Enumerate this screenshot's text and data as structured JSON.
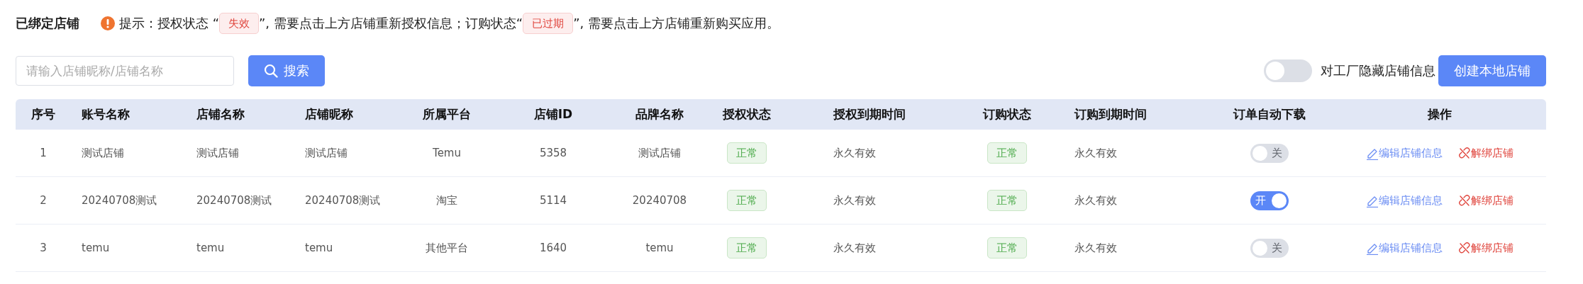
{
  "title": "已绑定店铺",
  "hint": [
    {
      "kind": "text",
      "text": "提示：授权状态 “"
    },
    {
      "kind": "tag",
      "text": "失效"
    },
    {
      "kind": "text",
      "text": "”, 需要点击上方店铺重新授权信息；订购状态“"
    },
    {
      "kind": "tag",
      "text": "已过期"
    },
    {
      "kind": "text",
      "text": "”, 需要点击上方店铺重新购买应用。"
    }
  ],
  "search": {
    "placeholder": "请输入店铺昵称/店铺名称",
    "button": "搜索"
  },
  "hide_from_factory": {
    "on": false,
    "label": "对工厂隐藏店铺信息"
  },
  "create_button": "创建本地店铺",
  "table": {
    "columns": [
      "序号",
      "账号名称",
      "店铺名称",
      "店铺昵称",
      "所属平台",
      "店铺ID",
      "品牌名称",
      "授权状态",
      "授权到期时间",
      "订购状态",
      "订购到期时间",
      "订单自动下载",
      "操作"
    ],
    "rows": [
      {
        "cells": [
          {
            "kind": "text",
            "text": "1"
          },
          {
            "kind": "text",
            "text": "测试店铺"
          },
          {
            "kind": "text",
            "text": "测试店铺"
          },
          {
            "kind": "text",
            "text": "测试店铺"
          },
          {
            "kind": "text",
            "text": "Temu"
          },
          {
            "kind": "text",
            "text": "5358"
          },
          {
            "kind": "text",
            "text": "测试店铺"
          },
          {
            "kind": "tag",
            "text": "正常"
          },
          {
            "kind": "text",
            "text": "永久有效"
          },
          {
            "kind": "tag",
            "text": "正常"
          },
          {
            "kind": "text",
            "text": "永久有效"
          },
          {
            "kind": "switch",
            "on": false,
            "text": "关"
          },
          {
            "kind": "actions",
            "actions": [
              {
                "kind": "edit",
                "text": "编辑店铺信息"
              },
              {
                "kind": "unbind",
                "text": "解绑店铺"
              }
            ]
          }
        ]
      },
      {
        "cells": [
          {
            "kind": "text",
            "text": "2"
          },
          {
            "kind": "text",
            "text": "20240708测试"
          },
          {
            "kind": "text",
            "text": "20240708测试"
          },
          {
            "kind": "text",
            "text": "20240708测试"
          },
          {
            "kind": "text",
            "text": "淘宝"
          },
          {
            "kind": "text",
            "text": "5114"
          },
          {
            "kind": "text",
            "text": "20240708"
          },
          {
            "kind": "tag",
            "text": "正常"
          },
          {
            "kind": "text",
            "text": "永久有效"
          },
          {
            "kind": "tag",
            "text": "正常"
          },
          {
            "kind": "text",
            "text": "永久有效"
          },
          {
            "kind": "switch",
            "on": true,
            "text": "开"
          },
          {
            "kind": "actions",
            "actions": [
              {
                "kind": "edit",
                "text": "编辑店铺信息"
              },
              {
                "kind": "unbind",
                "text": "解绑店铺"
              }
            ]
          }
        ]
      },
      {
        "cells": [
          {
            "kind": "text",
            "text": "3"
          },
          {
            "kind": "text",
            "text": "temu"
          },
          {
            "kind": "text",
            "text": "temu"
          },
          {
            "kind": "text",
            "text": "temu"
          },
          {
            "kind": "text",
            "text": "其他平台"
          },
          {
            "kind": "text",
            "text": "1640"
          },
          {
            "kind": "text",
            "text": "temu"
          },
          {
            "kind": "tag",
            "text": "正常"
          },
          {
            "kind": "text",
            "text": "永久有效"
          },
          {
            "kind": "tag",
            "text": "正常"
          },
          {
            "kind": "text",
            "text": "永久有效"
          },
          {
            "kind": "switch",
            "on": false,
            "text": "关"
          },
          {
            "kind": "actions",
            "actions": [
              {
                "kind": "edit",
                "text": "编辑店铺信息"
              },
              {
                "kind": "unbind",
                "text": "解绑店铺"
              }
            ]
          }
        ]
      }
    ]
  }
}
